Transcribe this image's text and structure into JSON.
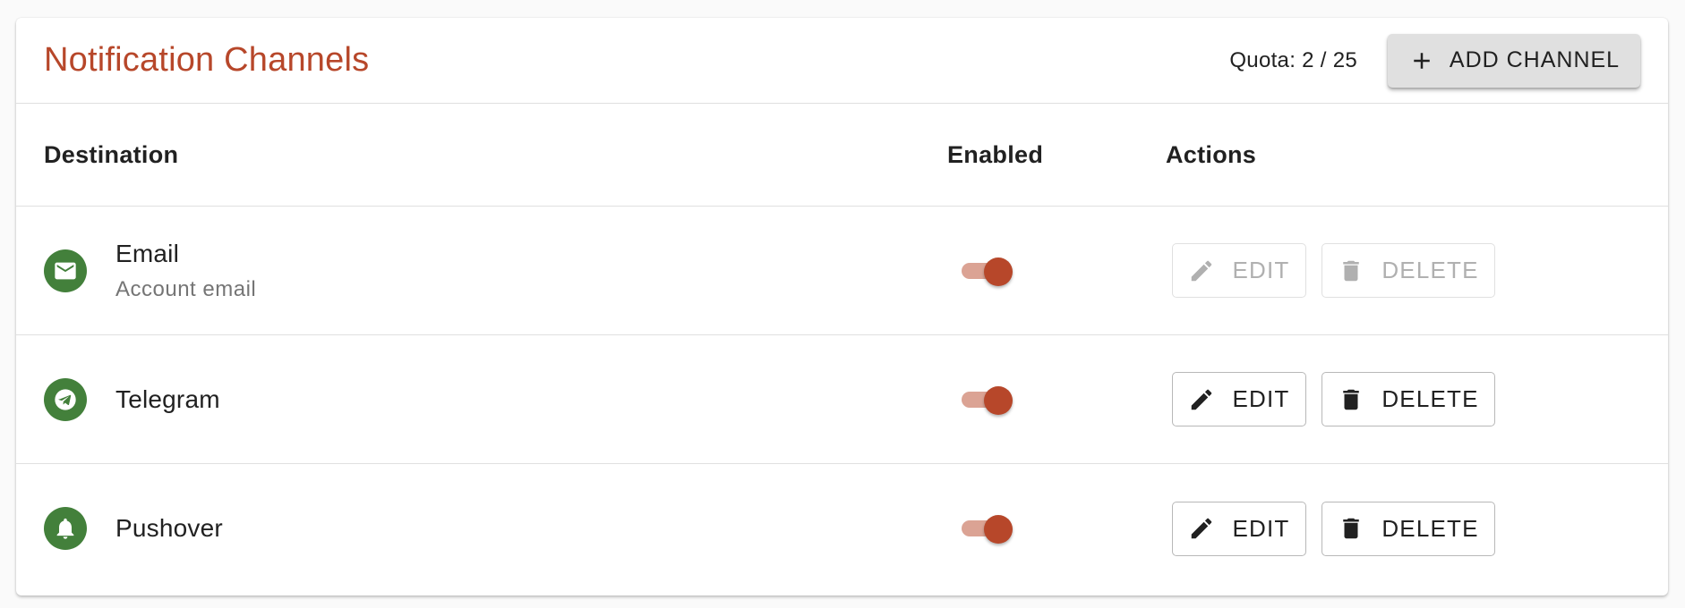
{
  "header": {
    "title": "Notification Channels",
    "quota": "Quota: 2 / 25",
    "add_button": {
      "label": "ADD CHANNEL",
      "icon": "plus-icon"
    }
  },
  "table": {
    "columns": [
      "Destination",
      "Enabled",
      "Actions"
    ],
    "rows": [
      {
        "name": "Email",
        "subtitle": "Account email",
        "icon": "email-icon",
        "enabled": true,
        "actions_disabled": true
      },
      {
        "name": "Telegram",
        "subtitle": "",
        "icon": "telegram-icon",
        "enabled": true,
        "actions_disabled": false
      },
      {
        "name": "Pushover",
        "subtitle": "",
        "icon": "bell-icon",
        "enabled": true,
        "actions_disabled": false
      }
    ],
    "edit_label": "EDIT",
    "delete_label": "DELETE"
  },
  "colors": {
    "accent": "#b7472a",
    "avatar": "#43803b"
  }
}
